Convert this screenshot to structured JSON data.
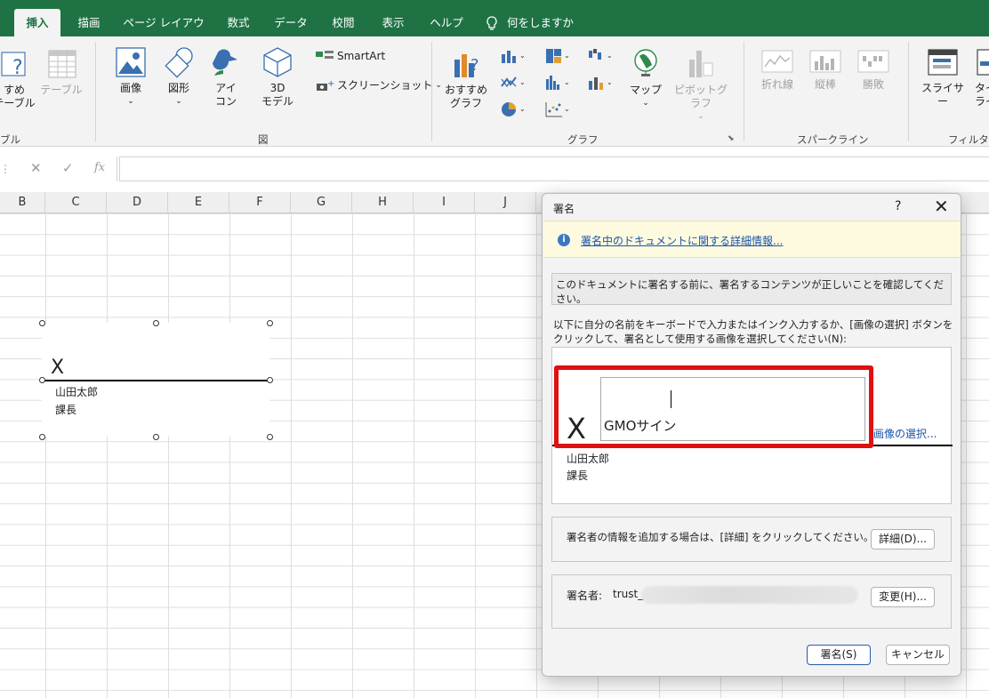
{
  "tabs": [
    {
      "label": "挿入",
      "active": true
    },
    {
      "label": "描画"
    },
    {
      "label": "ページ レイアウト"
    },
    {
      "label": "数式"
    },
    {
      "label": "データ"
    },
    {
      "label": "校閲"
    },
    {
      "label": "表示"
    },
    {
      "label": "ヘルプ"
    },
    {
      "label": "何をしますか"
    }
  ],
  "ribbon": {
    "recommended_table": "すめ\nテーブル",
    "table": "テーブル",
    "table_group": "ブル",
    "picture": "画像",
    "shapes": "図形",
    "icons": "アイ\nコン",
    "model3d": "3D\nモデル",
    "smartart": "SmartArt",
    "screenshot": "スクリーンショット",
    "illust_group": "図",
    "recommended_chart": "おすすめ\nグラフ",
    "maps": "マップ",
    "pivot_chart": "ピボットグラフ",
    "chart_group": "グラフ",
    "spark_line": "折れ線",
    "spark_column": "縦棒",
    "spark_winloss": "勝敗",
    "sparkline_group": "スパークライン",
    "slicer": "スライサー",
    "timeline": "タイ\nライ",
    "filter_group": "フィルター"
  },
  "formula_bar": {
    "cancel": "✕",
    "enter": "✓",
    "fx": "fx",
    "value": ""
  },
  "columns": [
    "B",
    "C",
    "D",
    "E",
    "F",
    "G",
    "H",
    "I",
    "J"
  ],
  "sheet_signature": {
    "x": "X",
    "name": "山田太郎",
    "title": "課長"
  },
  "dialog": {
    "title": "署名",
    "help": "?",
    "close": "✕",
    "info_link": "署名中のドキュメントに関する詳細情報...",
    "confirm_text": "このドキュメントに署名する前に、署名するコンテンツが正しいことを確認してください。",
    "instruction": "以下に自分の名前をキーボードで入力またはインク入力するか、[画像の選択] ボタンをクリックして、署名として使用する画像を選択してください(N):",
    "x": "X",
    "signature_input_value": "GMOサイン",
    "select_image": "画像の選択...",
    "signer_name": "山田太郎",
    "signer_title": "課長",
    "detail_text": "署名者の情報を追加する場合は、[詳細] をクリックしてください。",
    "detail_button": "詳細(D)...",
    "signer_label": "署名者:",
    "signer_value": "trust_",
    "change_button": "変更(H)...",
    "sign_button": "署名(S)",
    "cancel_button": "キャンセル"
  },
  "colors": {
    "excel_green": "#1f7244",
    "highlight_red": "#e01010",
    "link_blue": "#1a56a8"
  }
}
